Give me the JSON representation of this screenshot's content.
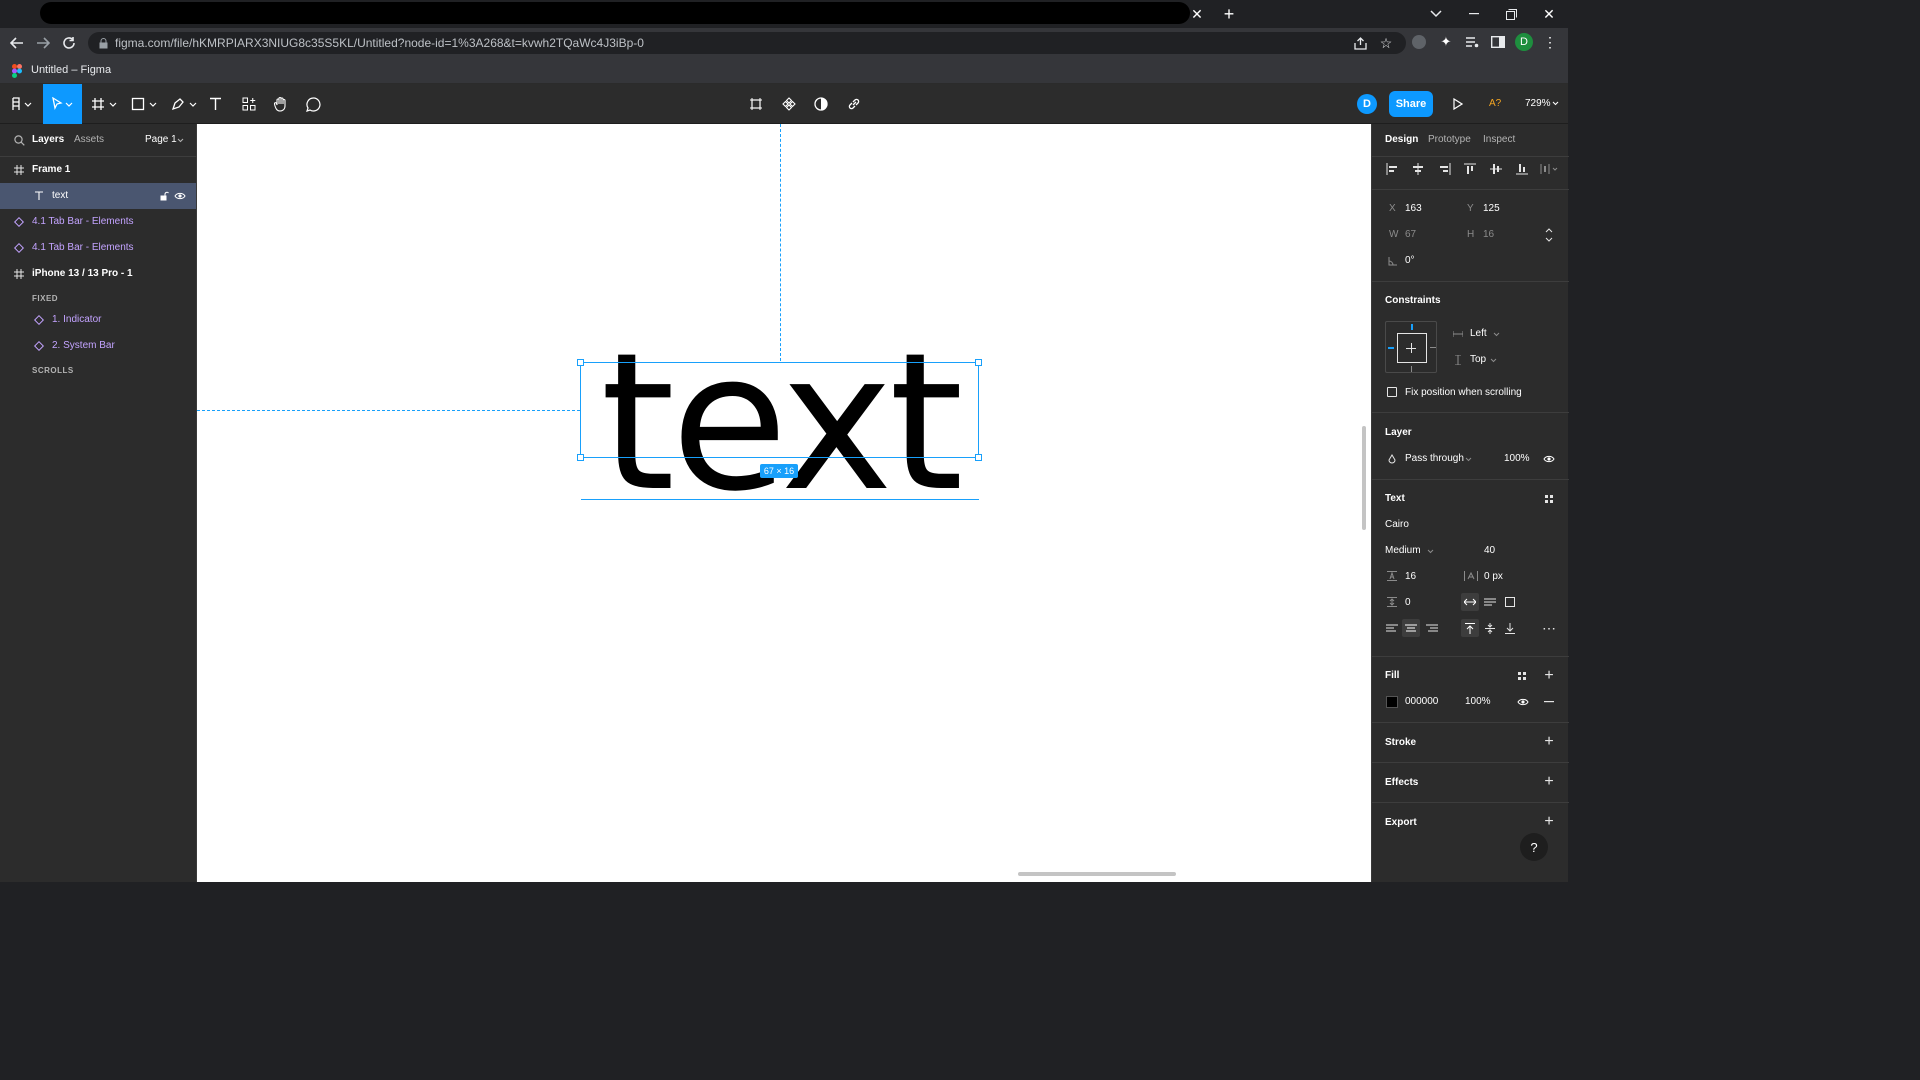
{
  "browser": {
    "url": "figma.com/file/hKMRPIARX3NIUG8c35S5KL/Untitled?node-id=1%3A268&t=kvwh2TQaWc4J3iBp-0",
    "bookmark_title": "Untitled – Figma",
    "profile_letter": "D"
  },
  "toolbar": {
    "share_label": "Share",
    "avatar_letter": "D",
    "font_warning": "A?",
    "zoom": "729%"
  },
  "left_panel": {
    "tabs": [
      "Layers",
      "Assets"
    ],
    "page": "Page 1",
    "layers": [
      {
        "name": "Frame 1",
        "type": "frame",
        "indent": 0
      },
      {
        "name": "text",
        "type": "text",
        "indent": 1,
        "selected": true
      },
      {
        "name": "4.1 Tab Bar - Elements",
        "type": "component",
        "indent": 0
      },
      {
        "name": "4.1 Tab Bar - Elements",
        "type": "component",
        "indent": 0
      },
      {
        "name": "iPhone 13 / 13 Pro - 1",
        "type": "frame",
        "indent": 0
      },
      {
        "name": "FIXED",
        "type": "group-label",
        "indent": 1
      },
      {
        "name": "1. Indicator",
        "type": "component",
        "indent": 1
      },
      {
        "name": "2. System Bar",
        "type": "component",
        "indent": 1
      },
      {
        "name": "SCROLLS",
        "type": "group-label",
        "indent": 1
      }
    ]
  },
  "canvas": {
    "text_content": "text",
    "size_badge": "67 × 16"
  },
  "right_panel": {
    "tabs": [
      "Design",
      "Prototype",
      "Inspect"
    ],
    "x_label": "X",
    "x": "163",
    "y_label": "Y",
    "y": "125",
    "w_label": "W",
    "w": "67",
    "h_label": "H",
    "h": "16",
    "rotation": "0°",
    "constraints_title": "Constraints",
    "constraint_h": "Left",
    "constraint_v": "Top",
    "fix_position": "Fix position when scrolling",
    "layer_title": "Layer",
    "blend_mode": "Pass through",
    "layer_opacity": "100%",
    "text_title": "Text",
    "font_family": "Cairo",
    "font_weight": "Medium",
    "font_size": "40",
    "line_height": "16",
    "letter_spacing": "0 px",
    "paragraph_spacing": "0",
    "fill_title": "Fill",
    "fill_hex": "000000",
    "fill_opacity": "100%",
    "stroke_title": "Stroke",
    "effects_title": "Effects",
    "export_title": "Export",
    "help": "?"
  },
  "colors": {
    "accent": "#0d99ff",
    "selection": "#18a0fb",
    "component": "#c3a3ff",
    "panel": "#2c2c2c"
  }
}
